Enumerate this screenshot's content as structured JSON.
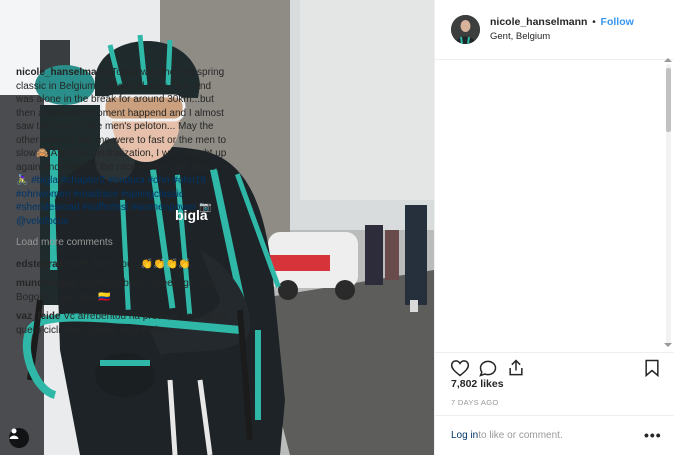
{
  "post": {
    "username": "nicole_hanselmann",
    "follow_label": "Follow",
    "location": "Gent, Belgium",
    "separator": "•"
  },
  "caption": {
    "username": "nicole_hanselmann",
    "text": " Today was the first spring classic in Belgium. I attacked after 7km, and was alone in the break for around 30km...but then a awkward moment happend and I almost saw the back of the men's peloton... May the other women and me were to fast or the men to slow🙈 After the neutralization, I was caught up again and finished the race on the 74th place. 🚴🏻‍♀️ ",
    "hashtags": [
      "#bigla",
      "#chapter2",
      "#endura",
      "#ohn",
      "#ohn19",
      "#ohnwomen",
      "#roadrace",
      "#springclassic",
      "#sheridesroad",
      "#sufferfest",
      "#womenpower"
    ],
    "photo_credit_prefix": " 📷: ",
    "photo_credit": "@velofocus"
  },
  "load_more_label": "Load more comments",
  "comments": [
    {
      "username": "edstegram",
      "text": " Well done you,, 👏👏👏👏"
    },
    {
      "username": "mundoluque",
      "text": " Unbelievable!!!! Greetings from Bogotá, Colombia 🇨🇴"
    },
    {
      "username": "vaz_leide",
      "text": " Vc arrebentou na prova, é uma pena que o ciclismo mundial seja muito"
    }
  ],
  "likes": "7,802 likes",
  "time_ago": "7 DAYS AGO",
  "login": {
    "link_label": "Log in",
    "suffix": " to like or comment.",
    "more_label": "•••"
  },
  "icons": [
    "heart-icon",
    "comment-icon",
    "share-icon",
    "bookmark-icon",
    "user-tag-icon",
    "more-options-icon"
  ],
  "colors": {
    "follow": "#3897f0",
    "hashtag": "#003569",
    "muted": "#999999",
    "jersey_teal": "#2fb7a7"
  }
}
